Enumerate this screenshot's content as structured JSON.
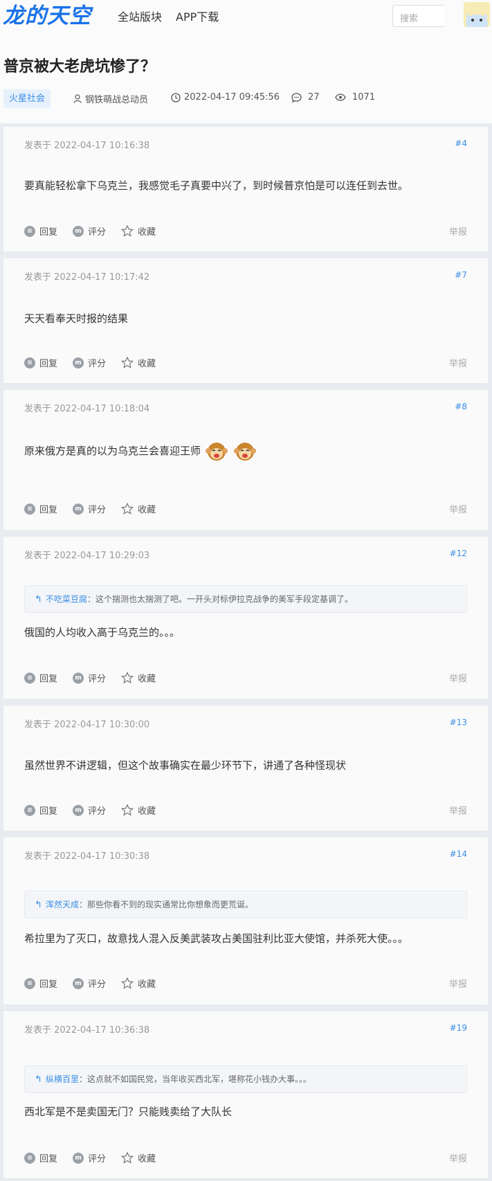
{
  "header": {
    "logo": "龙的天空",
    "nav": [
      "全站版块",
      "APP下载"
    ],
    "search_placeholder": "搜索"
  },
  "thread": {
    "title": "普京被大老虎坑惨了？",
    "board": "火星社会",
    "author": "钢铁萌战总动员",
    "time": "2022-04-17 09:45:56",
    "replies": "27",
    "views": "1071"
  },
  "labels": {
    "reply": "回复",
    "rate": "评分",
    "fav": "收藏",
    "report": "举报"
  },
  "posts": [
    {
      "time": "发表于 2022-04-17 10:16:38",
      "floor": "#4",
      "text": "要真能轻松拿下乌克兰，我感觉毛子真要中兴了，到时候普京怕是可以连任到去世。"
    },
    {
      "time": "发表于 2022-04-17 10:17:42",
      "floor": "#7",
      "text": "天天看奉天时报的结果"
    },
    {
      "time": "发表于 2022-04-17 10:18:04",
      "floor": "#8",
      "text": "原来俄方是真的以为乌克兰会喜迎王师"
    },
    {
      "time": "发表于 2022-04-17 10:29:03",
      "floor": "#12",
      "quote_user": "不吃菜豆腐",
      "quote_text": "：这个揣测也太揣测了吧。一开头对标伊拉克战争的美军手段定基调了。",
      "text": "俄国的人均收入高于乌克兰的。。。"
    },
    {
      "time": "发表于 2022-04-17 10:30:00",
      "floor": "#13",
      "text": "虽然世界不讲逻辑，但这个故事确实在最少环节下，讲通了各种怪现状"
    },
    {
      "time": "发表于 2022-04-17 10:30:38",
      "floor": "#14",
      "quote_user": "浑然天成",
      "quote_text": "：那些你看不到的现实通常比你想象而更荒诞。",
      "text": "希拉里为了灭口，故意找人混入反美武装攻占美国驻利比亚大使馆，并杀死大使。。。"
    },
    {
      "time": "发表于 2022-04-17 10:36:38",
      "floor": "#19",
      "quote_user": "纵横百里",
      "quote_text": "：这点就不如国民党，当年收买西北军，堪称花小钱办大事。。。",
      "text": "西北军是不是卖国无门？只能贱卖给了大队长"
    }
  ]
}
